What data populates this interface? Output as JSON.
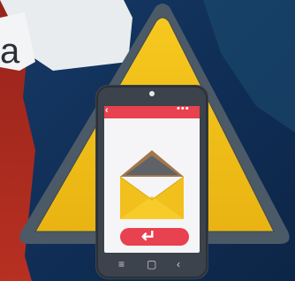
{
  "background": {
    "text_fragment": "a",
    "colors": {
      "navy": "#12315a",
      "red": "#b8261c",
      "teal": "#1d4a6b"
    }
  },
  "warning_sign": {
    "icon": "warning-triangle-icon",
    "colors": {
      "fill": "#f2c01c",
      "border": "#4b5a66"
    }
  },
  "phone": {
    "icon": "smartphone-icon",
    "status_bar": {
      "left_icon": "‹",
      "right_icon": "•••",
      "color": "#e8414f"
    },
    "body_color": "#3c434c",
    "screen_color": "#f5f5f7",
    "envelope": {
      "icon": "open-envelope-icon",
      "colors": {
        "body": "#f2c01c",
        "flap": "#a0764a",
        "inner": "#5f6266"
      }
    },
    "reply_button": {
      "icon": "reply-arrow-icon",
      "glyph": "↵",
      "color": "#e8414f"
    },
    "nav": {
      "menu": "≡",
      "home": "▢",
      "back": "‹"
    }
  }
}
